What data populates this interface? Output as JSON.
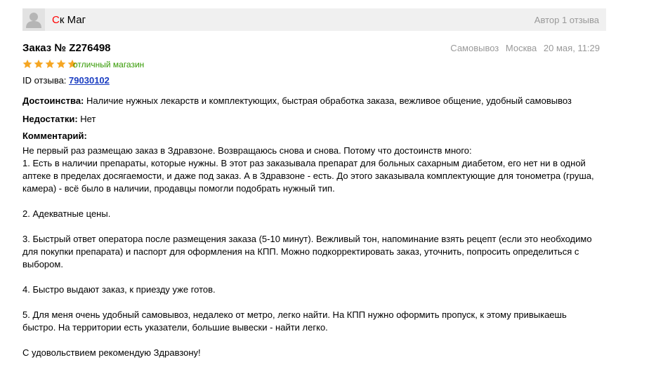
{
  "author": {
    "name_first_letter": "С",
    "name_rest": "к Маг",
    "stats": "Автор 1 отзыва",
    "avatar_icon": "user-silhouette-icon"
  },
  "order": {
    "title": "Заказ № Z276498",
    "delivery": "Самовывоз",
    "city": "Москва",
    "date": "20 мая, 11:29"
  },
  "rating": {
    "stars": 5,
    "max": 5,
    "star_color": "#f5a623",
    "text": "отличный магазин"
  },
  "review_id": {
    "label": "ID отзыва:",
    "value": "79030102"
  },
  "pros": {
    "label": "Достоинства:",
    "text": "Наличие нужных лекарств и комплектующих, быстрая обработка заказа, вежливое общение, удобный самовывоз"
  },
  "cons": {
    "label": "Недостатки:",
    "text": "Нет"
  },
  "comment": {
    "label": "Комментарий:",
    "lines": [
      "Не первый раз размещаю заказ в Здравзоне. Возвращаюсь снова и снова. Потому что достоинств много:",
      "1. Есть в наличии препараты, которые нужны. В этот раз заказывала препарат для больных сахарным диабетом, его нет ни в одной",
      "аптеке в пределах досягаемости, и даже под заказ. А в Здравзоне - есть. До этого заказывала комплектующие для тонометра (груша,",
      "камера) - всё было в наличии, продавцы помогли подобрать нужный тип.",
      "",
      "2. Адекватные цены.",
      "",
      "3. Быстрый ответ оператора после размещения заказа (5-10 минут). Вежливый тон, напоминание взять рецепт (если это необходимо",
      "для покупки препарата) и паспорт для оформления на КПП. Можно подкорректировать заказ, уточнить, попросить определиться с",
      "выбором.",
      "",
      "4. Быстро выдают заказ, к приезду уже готов.",
      "",
      "5. Для меня очень удобный самовывоз, недалеко от метро, легко найти. На КПП нужно оформить пропуск, к этому привыкаешь",
      "быстро. На территории есть указатели, большие вывески - найти легко.",
      "",
      "С удовольствием рекомендую Здравзону!"
    ]
  }
}
